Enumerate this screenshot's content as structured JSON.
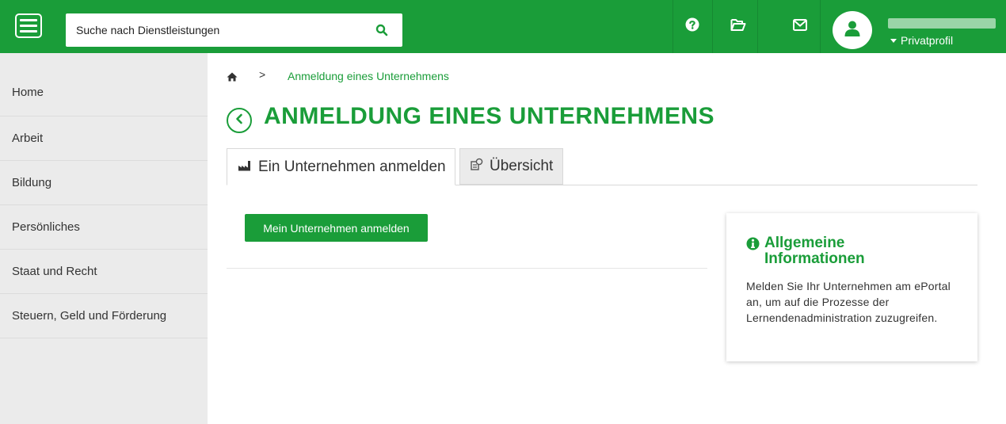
{
  "header": {
    "search_placeholder": "Suche nach Dienstleistungen",
    "profile_label": "Privatprofil",
    "icons": [
      "menu-icon",
      "search-icon",
      "help-icon",
      "folder-icon",
      "mail-icon",
      "user-icon"
    ],
    "brand_color": "#1a9d39"
  },
  "sidebar": {
    "items": [
      {
        "label": "Home"
      },
      {
        "label": "Arbeit"
      },
      {
        "label": "Bildung"
      },
      {
        "label": "Persönliches"
      },
      {
        "label": "Staat und Recht"
      },
      {
        "label": "Steuern, Geld und Förderung"
      }
    ]
  },
  "breadcrumb": {
    "separator": ">",
    "current": "Anmeldung eines Unternehmens"
  },
  "page": {
    "title": "ANMELDUNG EINES UNTERNEHMENS",
    "tabs": [
      {
        "label": "Ein Unternehmen anmelden",
        "active": true
      },
      {
        "label": "Übersicht",
        "active": false
      }
    ],
    "primary_button": "Mein Unternehmen anmelden"
  },
  "info": {
    "title": "Allgemeine Informationen",
    "text": "Melden Sie Ihr Unternehmen am ePortal an, um auf die Prozesse der Lernendenadministration zuzugreifen."
  }
}
